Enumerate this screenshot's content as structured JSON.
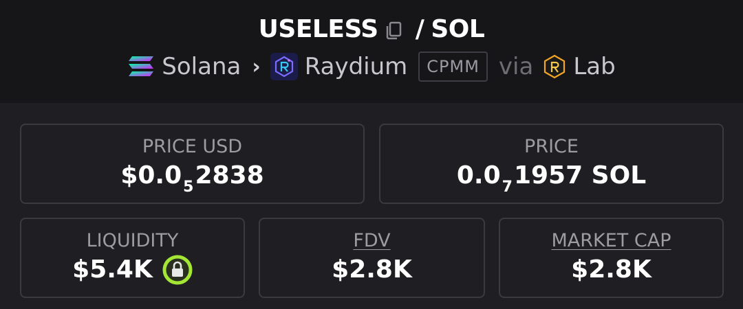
{
  "header": {
    "base_token": "USELESS",
    "separator": "/",
    "quote_token": "SOL",
    "chain": "Solana",
    "dex": "Raydium",
    "pool_type": "CPMM",
    "via_label": "via",
    "launchpad": "Lab",
    "icons": [
      "copy-icon",
      "solana-logo",
      "chevron-right-icon",
      "raydium-logo",
      "lab-logo"
    ]
  },
  "stats": {
    "price_usd": {
      "label": "PRICE USD",
      "prefix": "$0.0",
      "zeros": "5",
      "digits": "2838"
    },
    "price_native": {
      "label": "PRICE",
      "prefix": "0.0",
      "zeros": "7",
      "digits": "1957 SOL"
    },
    "liquidity": {
      "label": "LIQUIDITY",
      "value": "$5.4K",
      "lock_icon": "lock-icon"
    },
    "fdv": {
      "label": "FDV",
      "value": "$2.8K"
    },
    "market_cap": {
      "label": "MARKET CAP",
      "value": "$2.8K"
    }
  },
  "colors": {
    "background": "#1f1f23",
    "header_background": "#161619",
    "card_border": "#3a3a40",
    "lock_green": "#a3e635"
  }
}
